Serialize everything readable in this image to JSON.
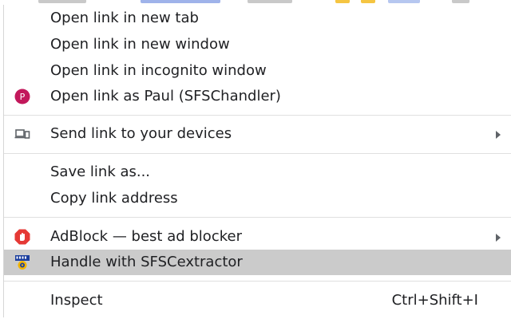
{
  "menu": {
    "items": [
      {
        "label": "Open link in new tab"
      },
      {
        "label": "Open link in new window"
      },
      {
        "label": "Open link in incognito window"
      },
      {
        "label": "Open link as Paul (SFSChandler)",
        "avatar_letter": "P"
      },
      {
        "label": "Send link to your devices"
      },
      {
        "label": "Save link as..."
      },
      {
        "label": "Copy link address"
      },
      {
        "label": "AdBlock — best ad blocker"
      },
      {
        "label": "Handle with SFSCextractor"
      },
      {
        "label": "Inspect",
        "shortcut": "Ctrl+Shift+I"
      }
    ],
    "icons": {
      "avatar": "profile-avatar-icon",
      "devices": "send-to-devices-icon",
      "adblock": "adblock-icon",
      "sfsc": "sfsc-extractor-icon"
    }
  },
  "colors": {
    "highlight": "#cbcbcb",
    "avatar_bg": "#c2185b",
    "adblock_red": "#e53935",
    "separator": "#e0e0e0"
  }
}
